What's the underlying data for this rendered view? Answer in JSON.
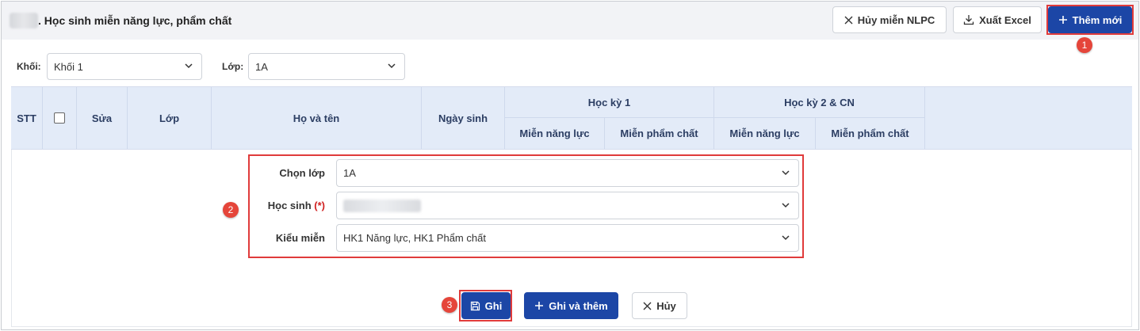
{
  "page": {
    "title": ". Học sinh miễn năng lực, phẩm chất"
  },
  "toolbar": {
    "cancel_exemption_label": "Hủy miễn NLPC",
    "export_label": "Xuất Excel",
    "add_new_label": "Thêm mới"
  },
  "filters": {
    "grade_label": "Khối:",
    "grade_value": "Khối 1",
    "class_label": "Lớp:",
    "class_value": "1A"
  },
  "grid": {
    "headers": {
      "stt": "STT",
      "edit": "Sửa",
      "class": "Lớp",
      "full_name": "Họ và tên",
      "birth_date": "Ngày sinh",
      "term1": "Học kỳ 1",
      "term2": "Học kỳ 2 & CN",
      "competence_exempt": "Miễn năng lực",
      "quality_exempt": "Miễn phẩm chất"
    }
  },
  "form": {
    "class_label": "Chọn lớp",
    "class_value": "1A",
    "student_label": "Học sinh",
    "student_required": "(*)",
    "exemption_label": "Kiểu miễn",
    "exemption_value": "HK1 Năng lực, HK1 Phẩm chất"
  },
  "actions": {
    "save_label": "Ghi",
    "save_and_add_label": "Ghi và thêm",
    "cancel_label": "Hủy"
  },
  "annotations": {
    "step1": "1",
    "step2": "2",
    "step3": "3"
  },
  "colors": {
    "primary": "#1c46a6",
    "highlight": "#e03b3b",
    "header_bg": "#e3ebf8",
    "step_badge": "#e5453a"
  },
  "icons": [
    "close-icon",
    "download-icon",
    "plus-icon",
    "chevron-down-icon",
    "save-icon"
  ]
}
